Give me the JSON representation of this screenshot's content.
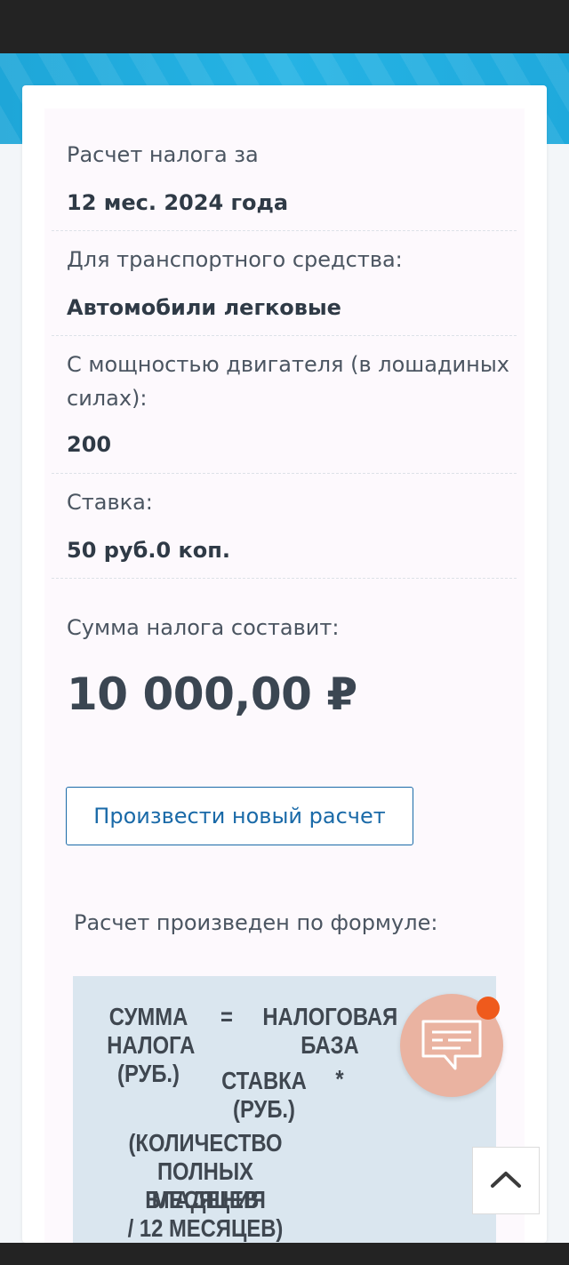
{
  "result": {
    "period_label": "Расчет налога за",
    "period_value": "12 мес. 2024 года",
    "vehicle_label": "Для транспортного средства:",
    "vehicle_value": "Автомобили легковые",
    "power_label_line1": "С мощностью двигателя (в лошадиных",
    "power_label_line2": "силах):",
    "power_value": "200",
    "rate_label": "Ставка:",
    "rate_value": "50 руб.0 коп.",
    "total_label": "Сумма налога составит:",
    "total_value": "10 000,00 ₽"
  },
  "actions": {
    "new_calc_label": "Произвести новый расчет"
  },
  "formula": {
    "caption": "Расчет произведен по формуле:",
    "sum_line1": "СУММА",
    "sum_line2": "НАЛОГА",
    "sum_line3": "(РУБ.)",
    "equals": "=",
    "base_line1": "НАЛОГОВАЯ",
    "base_line2": "БАЗА",
    "mult1": "*",
    "rate_line1": "СТАВКА",
    "rate_line2": "(РУБ.)",
    "mult2": "*",
    "months_line1": "(КОЛИЧЕСТВО",
    "months_line2": "ПОЛНЫХ МЕСЯЦЕВ",
    "months_line3": "ВЛАДЕНИЯ",
    "months_line4": "/ 12 МЕСЯЦЕВ)"
  },
  "colors": {
    "accent": "#1a6aa8",
    "chat_button": "#eab3a1",
    "chat_badge": "#ef5a1c",
    "formula_bg": "#dae6ef"
  },
  "icons": {
    "chat": "chat-icon",
    "scroll_top": "chevron-up-icon"
  }
}
